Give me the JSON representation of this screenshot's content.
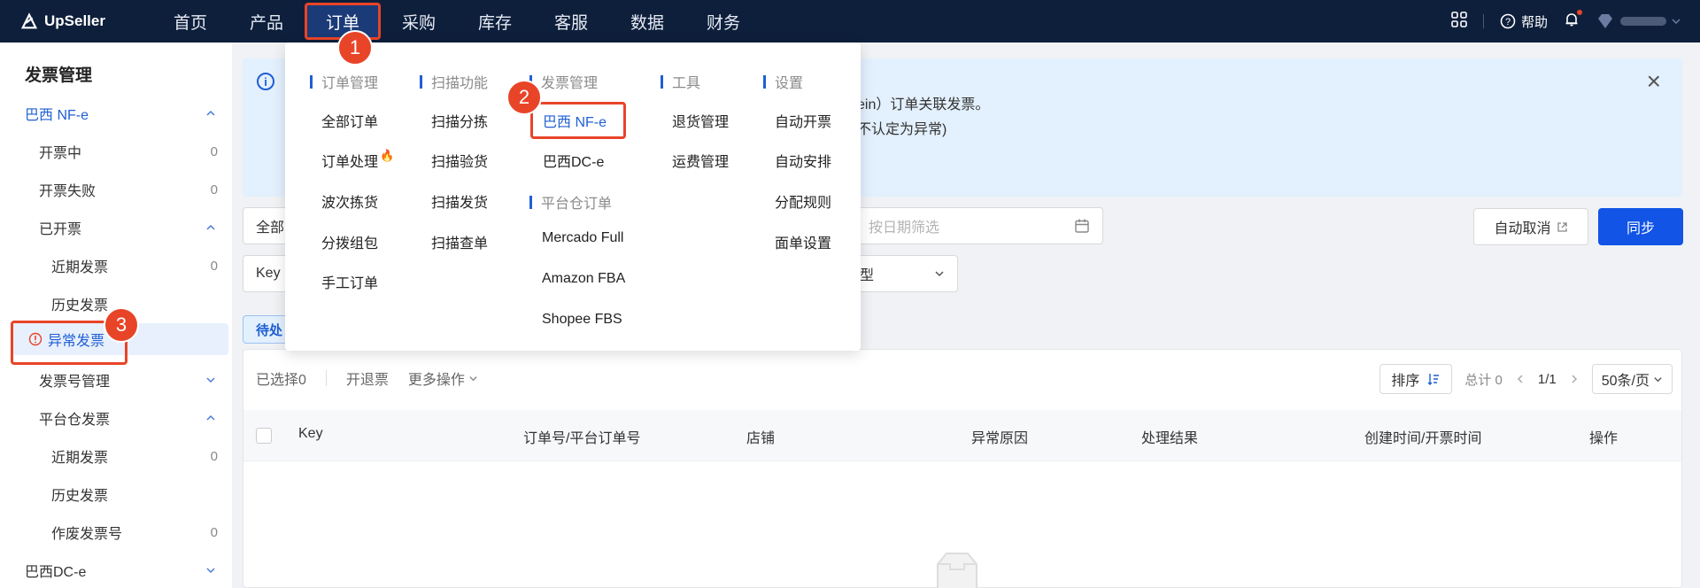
{
  "app": {
    "name": "UpSeller"
  },
  "nav": {
    "items": [
      "首页",
      "产品",
      "订单",
      "采购",
      "库存",
      "客服",
      "数据",
      "财务"
    ],
    "active": "订单"
  },
  "topright": {
    "help": "帮助"
  },
  "sidebar": {
    "title": "发票管理",
    "items": [
      {
        "label": "巴西 NF-e",
        "count": "",
        "chevron": "up"
      },
      {
        "label": "开票中",
        "count": "0"
      },
      {
        "label": "开票失败",
        "count": "0"
      },
      {
        "label": "已开票",
        "count": "",
        "chevron": "up"
      },
      {
        "label": "近期发票",
        "count": "0"
      },
      {
        "label": "历史发票",
        "count": ""
      },
      {
        "label": "异常发票",
        "count": ""
      },
      {
        "label": "发票号管理",
        "count": "",
        "chevron": "down"
      },
      {
        "label": "平台仓发票",
        "count": "",
        "chevron": "up"
      },
      {
        "label": "近期发票",
        "count": "0"
      },
      {
        "label": "历史发票",
        "count": ""
      },
      {
        "label": "作废发票号",
        "count": "0"
      },
      {
        "label": "巴西DC-e",
        "count": "",
        "chevron": "down"
      }
    ]
  },
  "banner": {
    "line1": "ein）订单关联发票。",
    "line2": "不认定为异常)"
  },
  "filters": {
    "status_value": "全部",
    "date_placeholder": "按日期筛选",
    "key_value": "Key",
    "type_value": "型"
  },
  "buttons": {
    "auto_cancel": "自动取消",
    "sync": "同步"
  },
  "tabs": {
    "pending": "待处"
  },
  "toolbar": {
    "selected": "已选择0",
    "open_return": "开退票",
    "more_actions": "更多操作",
    "sort": "排序",
    "total": "总计 0",
    "page": "1/1",
    "page_size": "50条/页"
  },
  "table": {
    "headers": [
      "Key",
      "订单号/平台订单号",
      "店铺",
      "异常原因",
      "处理结果",
      "创建时间/开票时间",
      "操作"
    ]
  },
  "mega_menu": {
    "columns": [
      {
        "head": "订单管理",
        "items": [
          "全部订单",
          "订单处理",
          "波次拣货",
          "分拨组包",
          "手工订单"
        ]
      },
      {
        "head": "扫描功能",
        "items": [
          "扫描分拣",
          "扫描验货",
          "扫描发货",
          "扫描查单"
        ]
      },
      {
        "head": "发票管理",
        "items": [
          "巴西 NF-e",
          "巴西DC-e"
        ],
        "head2": "平台仓订单",
        "items2": [
          "Mercado Full",
          "Amazon FBA",
          "Shopee FBS"
        ]
      },
      {
        "head": "工具",
        "items": [
          "退货管理",
          "运费管理"
        ]
      },
      {
        "head": "设置",
        "items": [
          "自动开票",
          "自动安排",
          "分配规则",
          "面单设置"
        ]
      }
    ]
  },
  "annotations": {
    "badge1": "1",
    "badge2": "2",
    "badge3": "3"
  },
  "colors": {
    "topbar": "#0e1f3b",
    "accent": "#1154e6",
    "annotation": "#e84428"
  }
}
